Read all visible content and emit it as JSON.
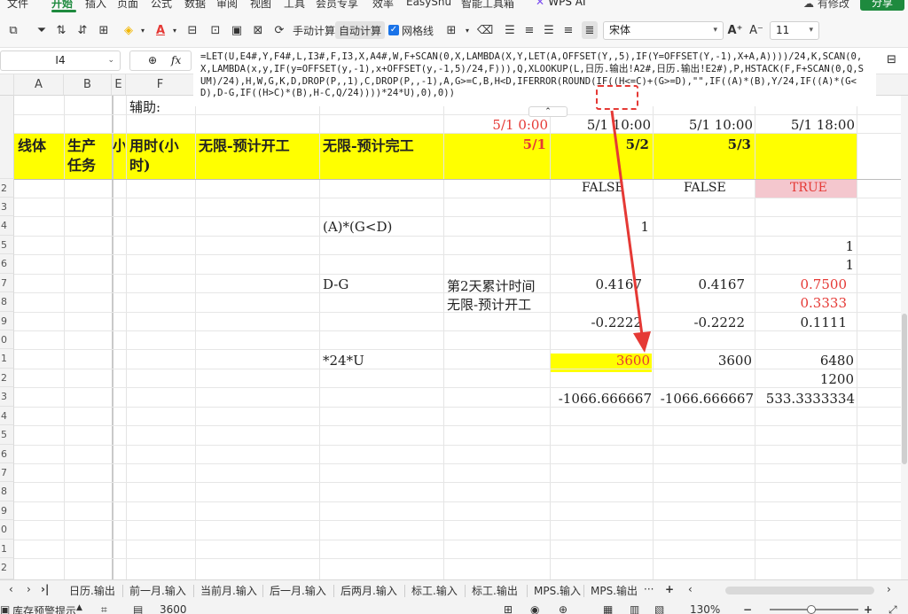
{
  "menu": {
    "items": [
      "文件",
      "开始",
      "插入",
      "页面",
      "公式",
      "数据",
      "审阅",
      "视图",
      "工具",
      "会员专享",
      "效率",
      "EasyShu",
      "智能工具箱"
    ],
    "active": "开始",
    "wps_ai": "WPS AI",
    "modified": "有修改",
    "share": "分享"
  },
  "toolbar": {
    "manual_calc": "手动计算",
    "auto_calc": "自动计算",
    "gridlines": "网格线",
    "font_name": "宋体",
    "font_size": "11",
    "font_color": "#e53935"
  },
  "formula_bar": {
    "cell_ref": "I4",
    "fx_label": "fx",
    "formula": "=LET(U,E4#,Y,F4#,L,I3#,F,I3,X,A4#,W,F+SCAN(0,X,LAMBDA(X,Y,LET(A,OFFSET(Y,,5),IF(Y=OFFSET(Y,-1),X+A,A))))/24,K,SCAN(0,X,LAMBDA(x,y,IF(y=OFFSET(y,-1),x+OFFSET(y,-1,5)/24,F))),Q,XLOOKUP(L,日历.输出!A2#,日历.输出!E2#),P,HSTACK(F,F+SCAN(0,Q,SUM)/24),H,W,G,K,D,DROP(P,,1),C,DROP(P,,-1),A,G>=C,B,H<D,IFERROR(ROUND(IF((H<=C)+(G>=D),\"\",IF((A)*(B),Y/24,IF((A)*(G<D),D-G,IF((H>C)*(B),H-C,Q/24))))*24*U),0),0))"
  },
  "columns": [
    "A",
    "B",
    "E",
    "F"
  ],
  "row_numbers": [
    "2",
    "3",
    "4",
    "5",
    "6",
    "7",
    "8",
    "9",
    "0",
    "1",
    "2",
    "3",
    "4",
    "5",
    "6",
    "7",
    "8",
    "9",
    "0",
    "1",
    "2"
  ],
  "sheet": {
    "helper_label": "辅助:",
    "top_right_digit": "8",
    "times": [
      "5/1 0:00",
      "5/1 10:00",
      "5/1 10:00",
      "5/1 18:00"
    ],
    "header_row": {
      "col_a": "线体",
      "col_b": "生产\n任务",
      "col_e": "小",
      "col_f": "用时(小\n时)",
      "col_g": "无限-预计开工",
      "col_h": "无限-预计完工",
      "dates": [
        "5/1",
        "5/2",
        "5/3"
      ]
    },
    "bool_row": [
      "FALSE",
      "FALSE",
      "TRUE"
    ],
    "expr1_label": "(A)*(G<D)",
    "expr1_value": "1",
    "ones": [
      "1",
      "1"
    ],
    "dg_label": "D-G",
    "cum_time_label": "第2天累计时间",
    "start_label": "无限-预计开工",
    "dg_values": [
      "0.4167",
      "0.4167",
      "0.7500"
    ],
    "start_value": "0.3333",
    "neg_values": [
      "-0.2222",
      "-0.2222",
      "0.1111"
    ],
    "u_label": "*24*U",
    "u_values": [
      "3600",
      "3600",
      "6480"
    ],
    "extra_value": "1200",
    "last_values": [
      "-1066.666667",
      "-1066.666667",
      "533.3333334"
    ]
  },
  "tabs": [
    "日历.输出",
    "前一月.输入",
    "当前月.输入",
    "后一月.输入",
    "后两月.输入",
    "标工.输入",
    "标工.输出",
    "MPS.输入",
    "MPS.输出"
  ],
  "status": {
    "stock_alert": "库存预警提示",
    "sum_value": "3600",
    "zoom": "130%"
  }
}
